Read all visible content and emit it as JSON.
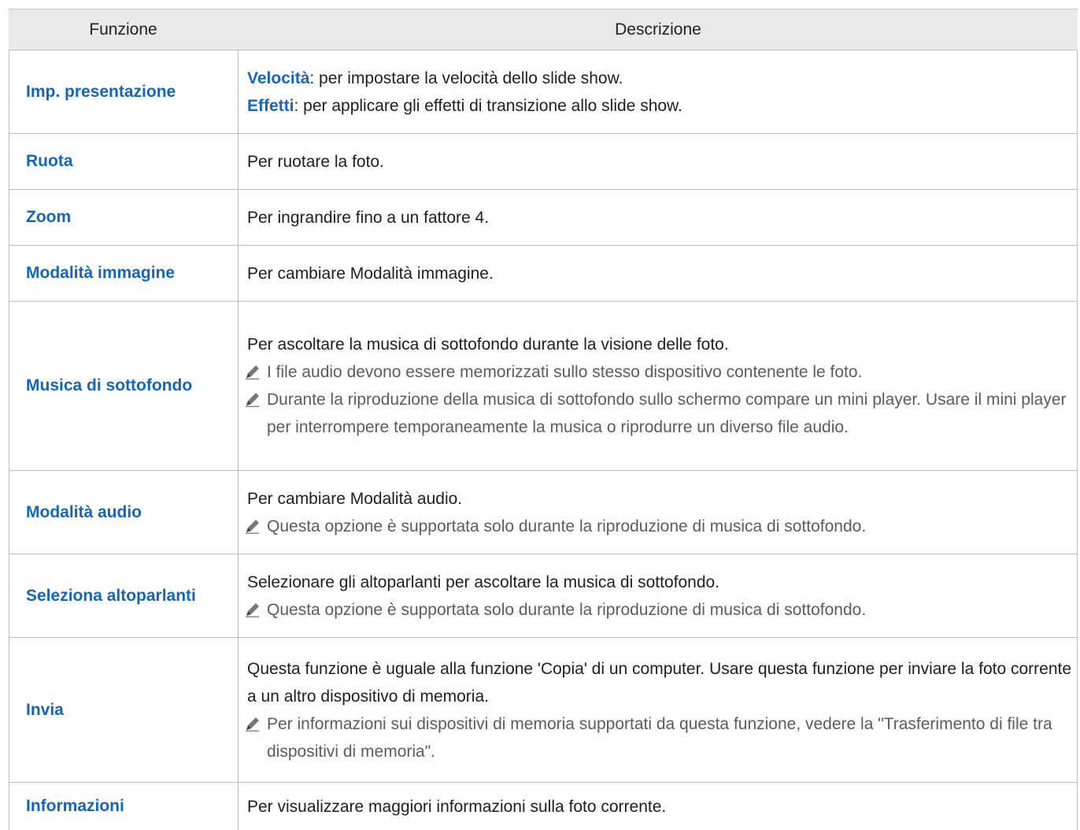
{
  "table": {
    "headers": [
      "Funzione",
      "Descrizione"
    ],
    "rows": [
      {
        "function": "Imp. presentazione",
        "lines": [
          {
            "kw": "Velocità",
            "text": ": per impostare la velocità dello slide show."
          },
          {
            "kw": "Effetti",
            "text": ": per applicare gli effetti di transizione allo slide show."
          }
        ]
      },
      {
        "function": "Ruota",
        "text": "Per ruotare la foto."
      },
      {
        "function": "Zoom",
        "text": "Per ingrandire fino a un fattore 4."
      },
      {
        "function": "Modalità immagine",
        "text": "Per cambiare Modalità immagine."
      },
      {
        "function": "Musica di sottofondo",
        "text": "Per ascoltare la musica di sottofondo durante la visione delle foto.",
        "notes": [
          "I file audio devono essere memorizzati sullo stesso dispositivo contenente le foto.",
          "Durante la riproduzione della musica di sottofondo sullo schermo compare un mini player. Usare il mini player per interrompere temporaneamente la musica o riprodurre un diverso file audio."
        ]
      },
      {
        "function": "Modalità audio",
        "text": "Per cambiare Modalità audio.",
        "notes": [
          "Questa opzione è supportata solo durante la riproduzione di musica di sottofondo."
        ]
      },
      {
        "function": "Seleziona altoparlanti",
        "text": "Selezionare gli altoparlanti per ascoltare la musica di sottofondo.",
        "notes": [
          "Questa opzione è supportata solo durante la riproduzione di musica di sottofondo."
        ]
      },
      {
        "function": "Invia",
        "text": "Questa funzione è uguale alla funzione 'Copia' di un computer. Usare questa funzione per inviare la foto corrente a un altro dispositivo di memoria.",
        "notes": [
          "Per informazioni sui dispositivi di memoria supportati da questa funzione, vedere la \"Trasferimento di file tra dispositivi di memoria\"."
        ]
      },
      {
        "function": "Informazioni",
        "text": "Per visualizzare maggiori informazioni sulla foto corrente."
      }
    ],
    "note_icon": "pencil-note-icon"
  }
}
